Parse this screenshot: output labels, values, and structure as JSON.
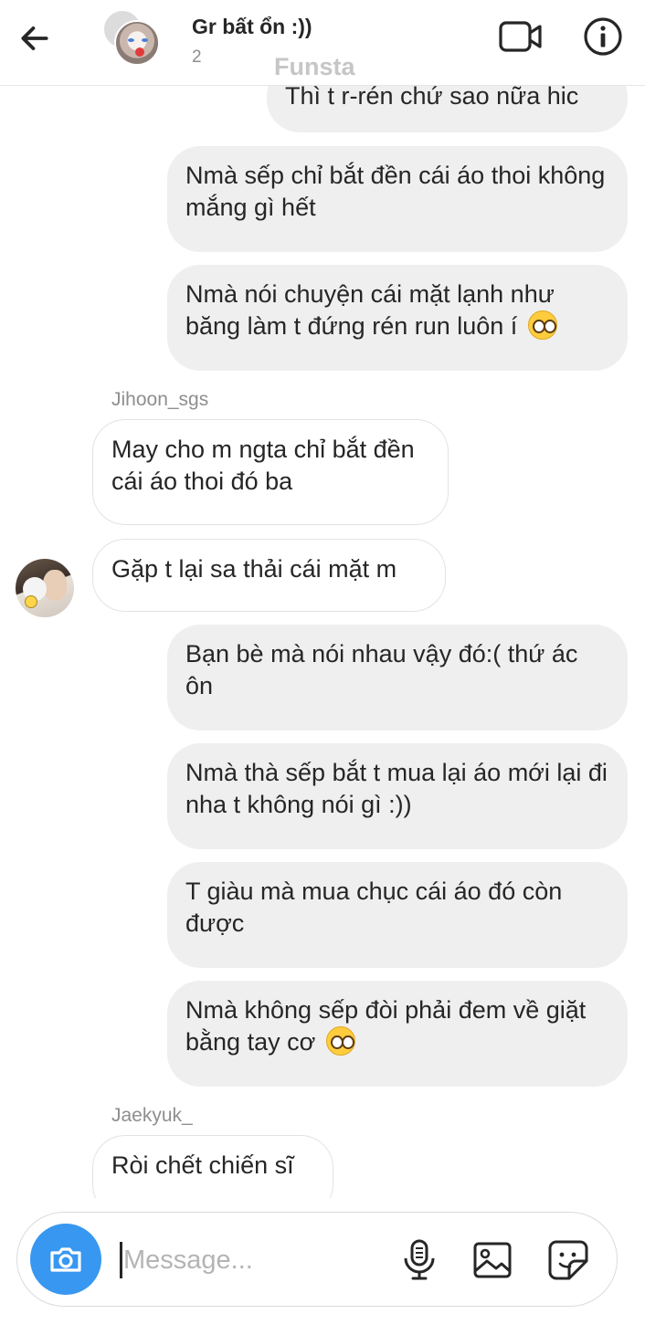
{
  "header": {
    "title": "Gr bất ổn :))",
    "member_count": "2",
    "watermark": "Funsta"
  },
  "messages": [
    {
      "text": "Thì t r-rén chứ sao nữa hic"
    },
    {
      "text": "Nmà sếp chỉ bắt đền cái áo thoi không mắng gì hết"
    },
    {
      "text": "Nmà nói chuyện cái mặt lạnh như băng làm t đứng rén run luôn í"
    },
    {
      "text": "May cho m ngta chỉ bắt đền cái áo thoi đó ba"
    },
    {
      "text": "Gặp t lại sa thải cái mặt m"
    },
    {
      "text": "Bạn bè mà nói nhau vậy đó:( thứ ác ôn"
    },
    {
      "text": "Nmà thà sếp bắt t mua lại áo mới lại đi nha t không nói gì :))"
    },
    {
      "text": "T giàu mà mua chục cái áo đó còn được"
    },
    {
      "text": "Nmà không sếp đòi phải đem về giặt bằng tay cơ"
    },
    {
      "text": "Ròi chết chiến sĩ"
    }
  ],
  "senders": {
    "first": "Jihoon_sgs",
    "second": "Jaekyuk_"
  },
  "composer": {
    "placeholder": "Message..."
  },
  "icons": {
    "back": "arrow-left-icon",
    "video": "video-camera-icon",
    "info": "info-icon",
    "camera": "camera-icon",
    "mic": "microphone-icon",
    "gallery": "image-icon",
    "sticker": "sticker-icon",
    "emoji": "pleading-face-emoji"
  },
  "colors": {
    "camera_button": "#3897f0",
    "outgoing_bubble": "#efefef",
    "secondary_text": "#8e8e8e"
  }
}
